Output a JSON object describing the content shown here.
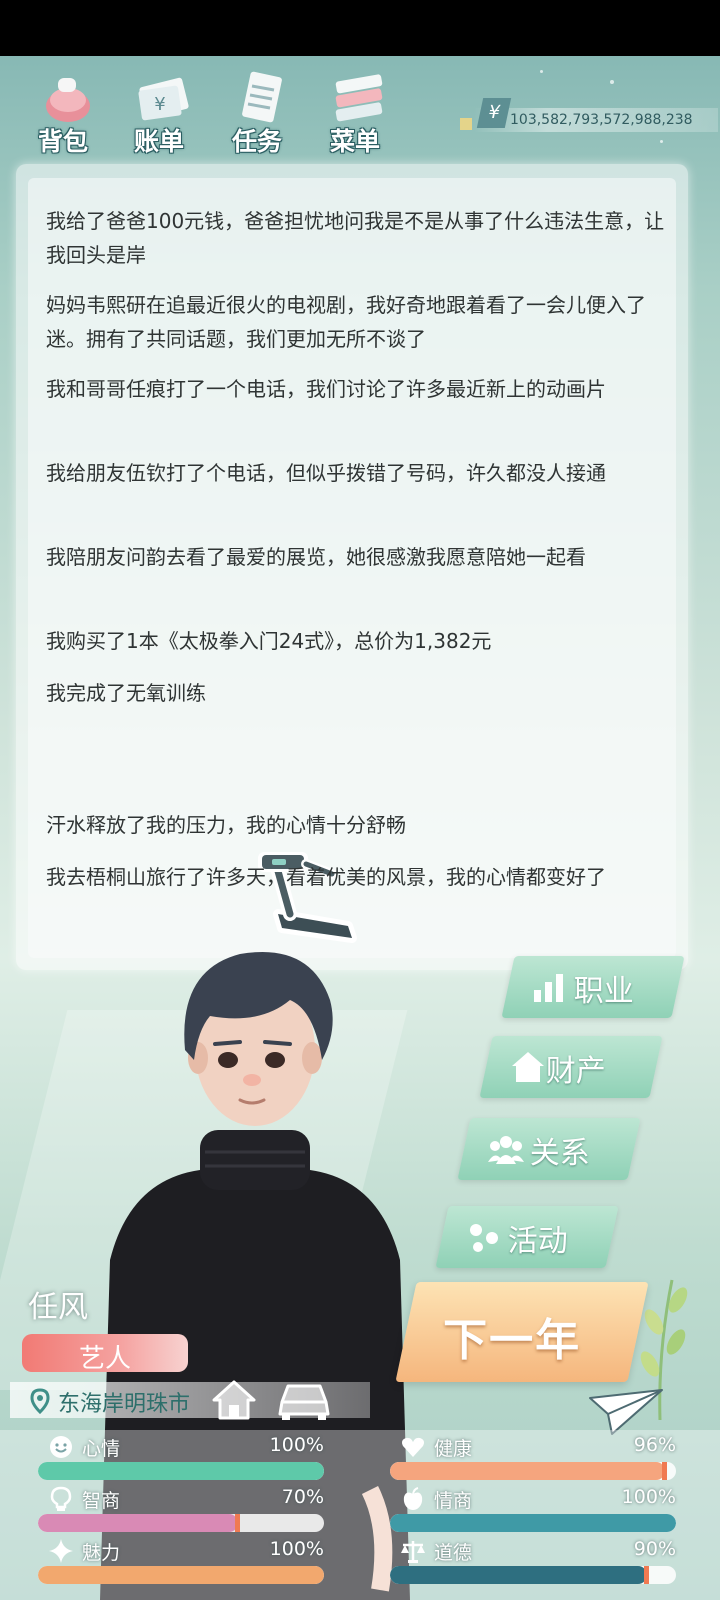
{
  "top_nav": {
    "items": [
      {
        "label": "背包",
        "icon": "backpack-icon"
      },
      {
        "label": "账单",
        "icon": "bill-icon"
      },
      {
        "label": "任务",
        "icon": "task-icon"
      },
      {
        "label": "菜单",
        "icon": "menu-icon"
      }
    ]
  },
  "money": {
    "symbol": "¥",
    "value": "103,582,793,572,988,238"
  },
  "log": {
    "entries": [
      "我给了爸爸100元钱，爸爸担忧地问我是不是从事了什么违法生意，让我回头是岸",
      "妈妈韦熙研在追最近很火的电视剧，我好奇地跟着看了一会儿便入了迷。拥有了共同话题，我们更加无所不谈了",
      "我和哥哥任痕打了一个电话，我们讨论了许多最近新上的动画片",
      "我给朋友伍钦打了个电话，但似乎拨错了号码，许久都没人接通",
      "我陪朋友问韵去看了最爱的展览，她很感激我愿意陪她一起看",
      "我购买了1本《太极拳入门24式》，总价为1,382元",
      "我完成了无氧训练",
      "汗水释放了我的压力，我的心情十分舒畅",
      "我去梧桐山旅行了许多天，看着优美的风景，我的心情都变好了"
    ],
    "illustration": "treadmill-icon"
  },
  "side_buttons": [
    {
      "label": "职业",
      "icon": "career-chart-icon"
    },
    {
      "label": "财产",
      "icon": "house-property-icon"
    },
    {
      "label": "关系",
      "icon": "people-icon"
    },
    {
      "label": "活动",
      "icon": "activity-icon"
    }
  ],
  "next_year": {
    "label": "下一年"
  },
  "character": {
    "name": "任风",
    "job": "艺人",
    "location": "东海岸明珠市"
  },
  "stats": [
    {
      "name": "心情",
      "value": "100%",
      "level": 1.0,
      "color": "#5ec9a9",
      "icon": "smile-icon"
    },
    {
      "name": "健康",
      "value": "96%",
      "level": 0.96,
      "color": "#f5a57e",
      "icon": "heart-icon"
    },
    {
      "name": "智商",
      "value": "70%",
      "level": 0.7,
      "color": "#d98ab5",
      "icon": "bulb-icon"
    },
    {
      "name": "情商",
      "value": "100%",
      "level": 1.0,
      "color": "#3f9aa6",
      "icon": "apple-icon"
    },
    {
      "name": "魅力",
      "value": "100%",
      "level": 1.0,
      "color": "#f2a86e",
      "icon": "sparkle-icon"
    },
    {
      "name": "道德",
      "value": "90%",
      "level": 0.9,
      "color": "#2e6f80",
      "icon": "scale-icon"
    }
  ]
}
